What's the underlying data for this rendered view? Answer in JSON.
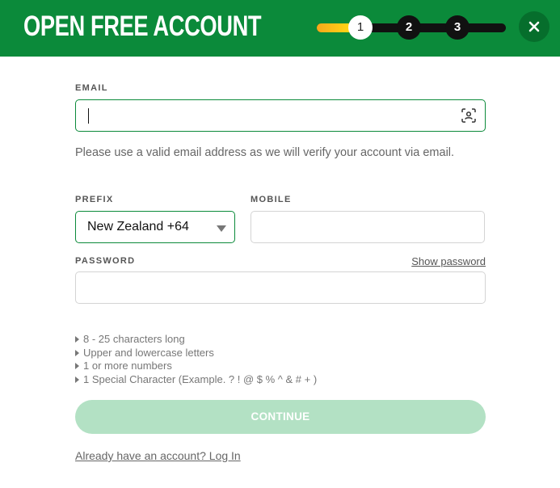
{
  "header": {
    "title": "OPEN FREE ACCOUNT",
    "steps": [
      "1",
      "2",
      "3"
    ],
    "current_step": 1,
    "progress_fraction": 0.17,
    "close_icon": "close-icon"
  },
  "form": {
    "email": {
      "label": "EMAIL",
      "value": "",
      "icon": "contact-scan-icon",
      "hint": "Please use a valid email address as we will verify your account via email."
    },
    "prefix": {
      "label": "PREFIX",
      "value": "New Zealand +64"
    },
    "mobile": {
      "label": "MOBILE",
      "value": ""
    },
    "password": {
      "label": "PASSWORD",
      "show_label": "Show password",
      "value": ""
    },
    "rules": [
      "8 - 25 characters long",
      "Upper and lowercase letters",
      "1 or more numbers",
      "1 Special Character (Example. ? ! @ $ % ^ & # + )"
    ],
    "continue_label": "CONTINUE",
    "login_link": "Already have an account? Log In"
  },
  "colors": {
    "brand_green": "#0b8a3a",
    "close_bg": "#066e2c",
    "progress_yellow": "#ffd516",
    "button_disabled": "#b3e1c4"
  }
}
